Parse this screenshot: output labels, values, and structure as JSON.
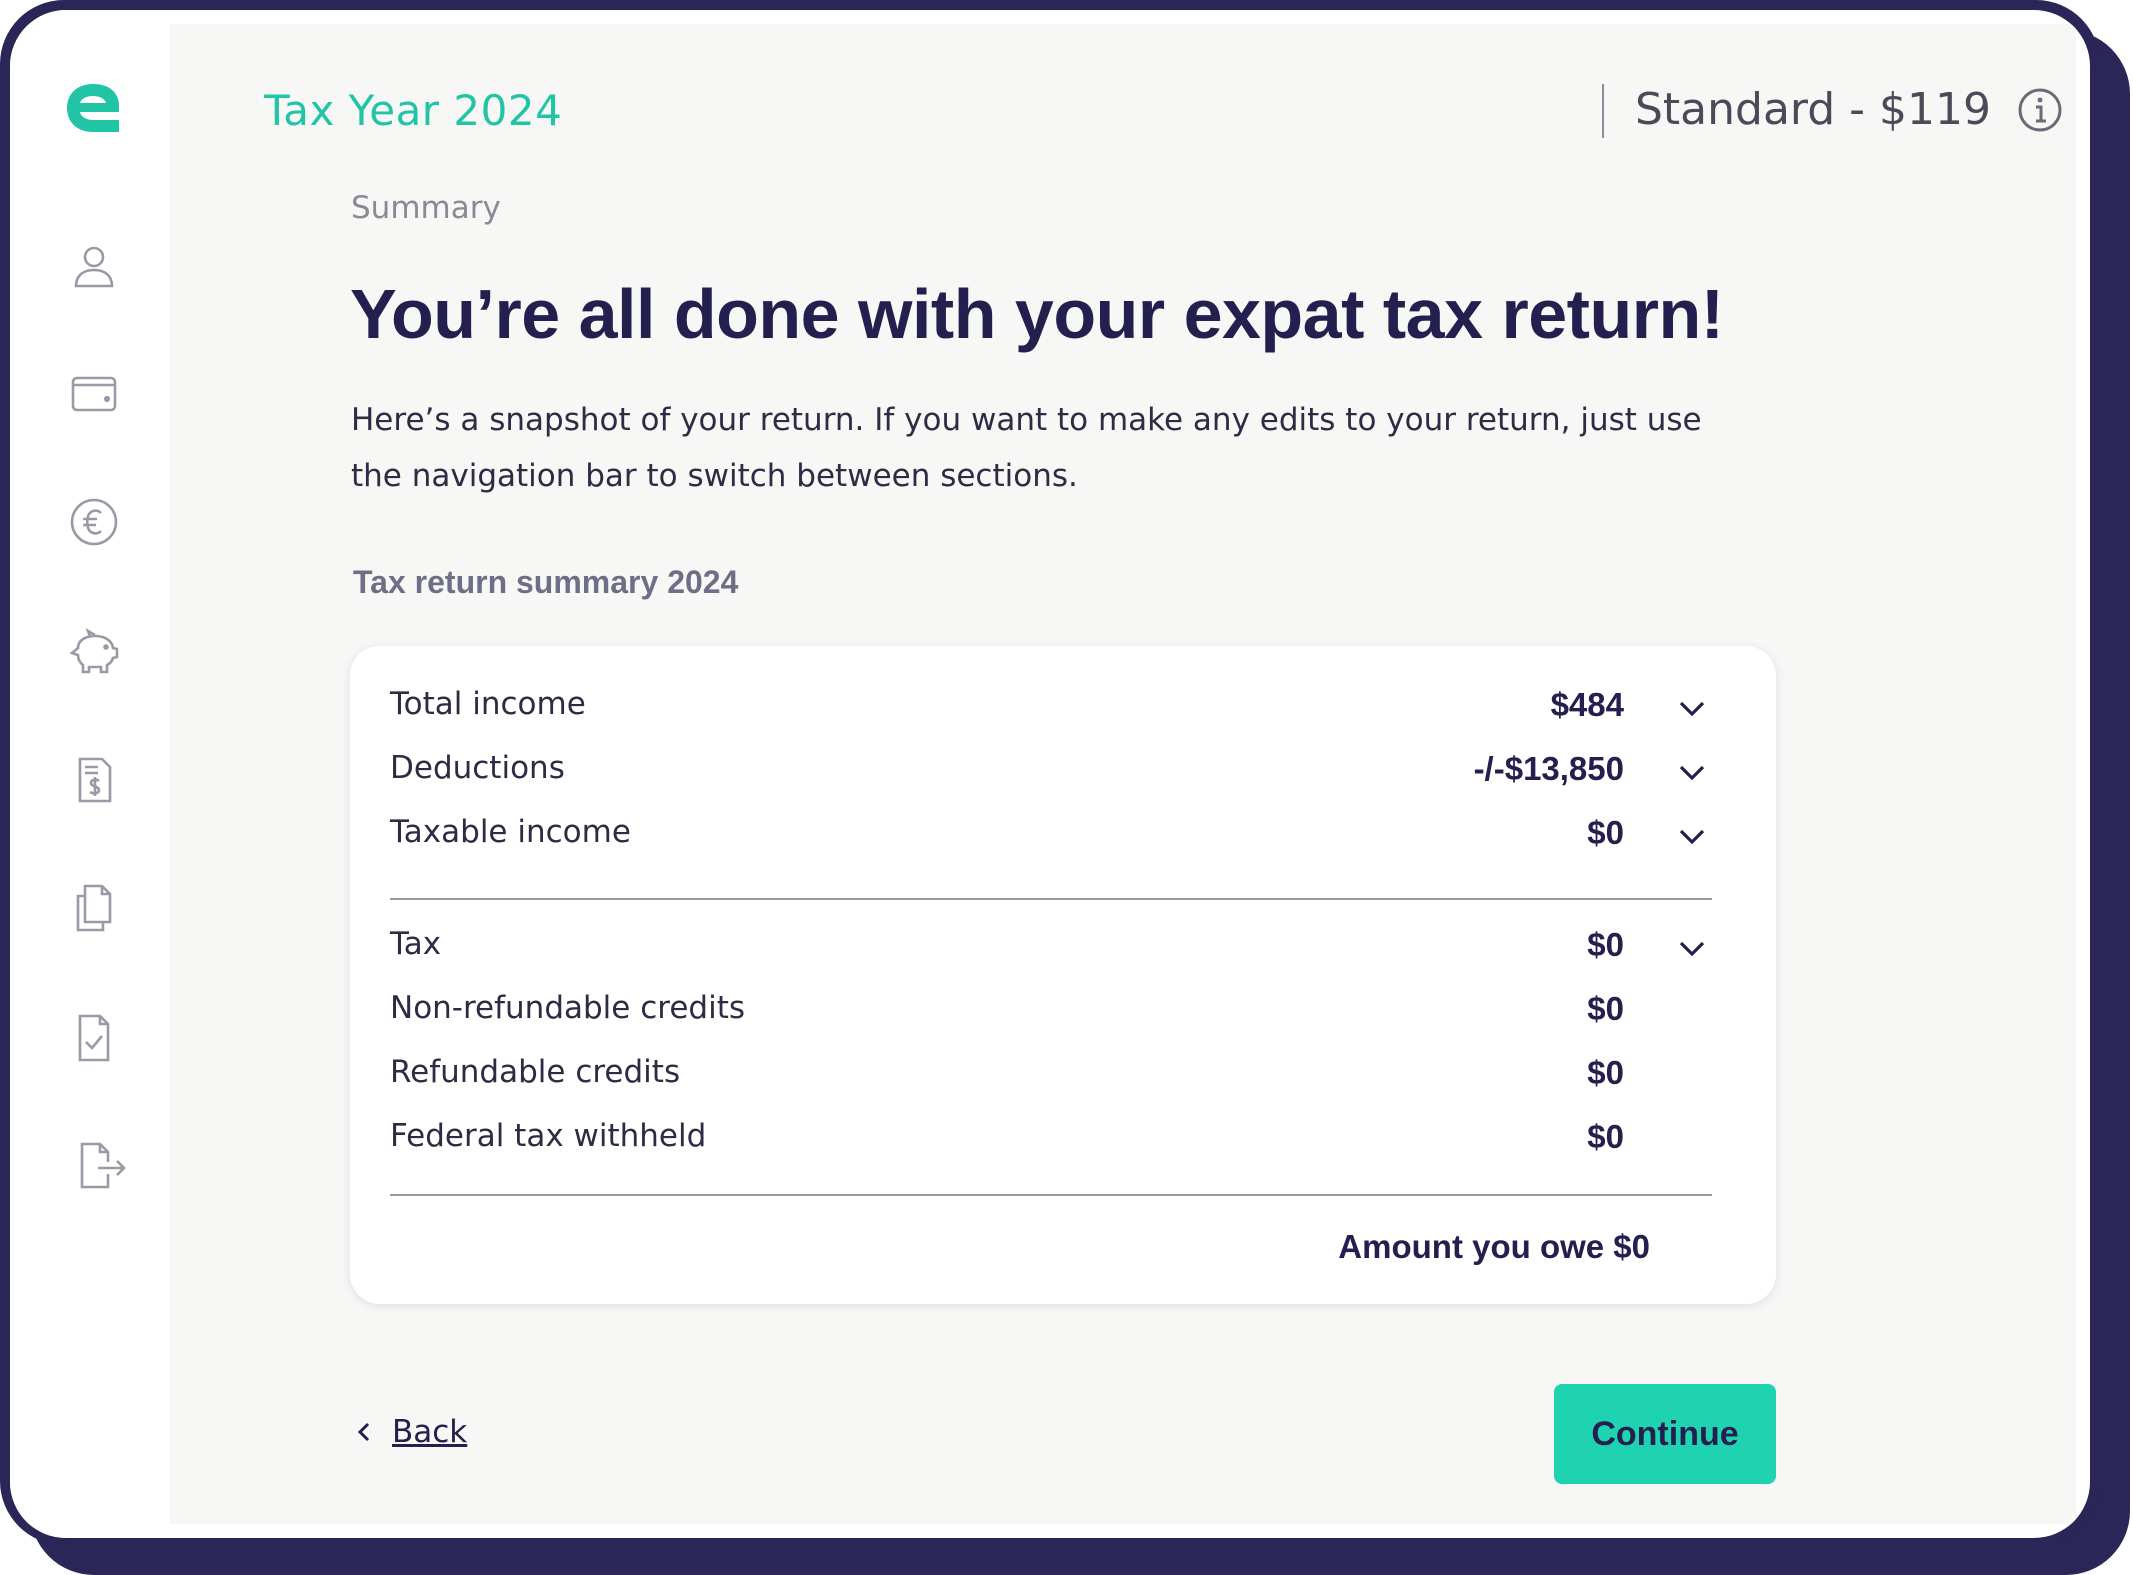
{
  "header": {
    "tax_year": "Tax Year 2024",
    "plan": "Standard - $119"
  },
  "sidebar": {
    "items": [
      {
        "icon": "user-icon"
      },
      {
        "icon": "wallet-icon"
      },
      {
        "icon": "euro-icon"
      },
      {
        "icon": "piggy-bank-icon"
      },
      {
        "icon": "receipt-icon"
      },
      {
        "icon": "documents-icon"
      },
      {
        "icon": "checklist-icon"
      },
      {
        "icon": "export-icon"
      }
    ]
  },
  "main": {
    "breadcrumb": "Summary",
    "headline": "You’re all done with your expat tax return!",
    "lead": "Here’s a snapshot of your return. If you want to make any edits to your return, just use the navigation bar to switch between sections.",
    "summary_title": "Tax return summary 2024"
  },
  "summary": {
    "rows": [
      {
        "label": "Total income",
        "value": "$484",
        "expandable": true
      },
      {
        "label": "Deductions",
        "value": "-/-$13,850",
        "expandable": true
      },
      {
        "label": "Taxable income",
        "value": "$0",
        "expandable": true
      },
      {
        "label": "Tax",
        "value": "$0",
        "expandable": true
      },
      {
        "label": "Non-refundable credits",
        "value": "$0",
        "expandable": false
      },
      {
        "label": "Refundable credits",
        "value": "$0",
        "expandable": false
      },
      {
        "label": "Federal tax withheld",
        "value": "$0",
        "expandable": false
      }
    ],
    "amount_owed": "Amount you owe $0"
  },
  "footer": {
    "back_label": "Back",
    "continue_label": "Continue"
  },
  "colors": {
    "accent": "#1fd2b0",
    "brand_dark": "#2a2658",
    "heading": "#23204f"
  }
}
